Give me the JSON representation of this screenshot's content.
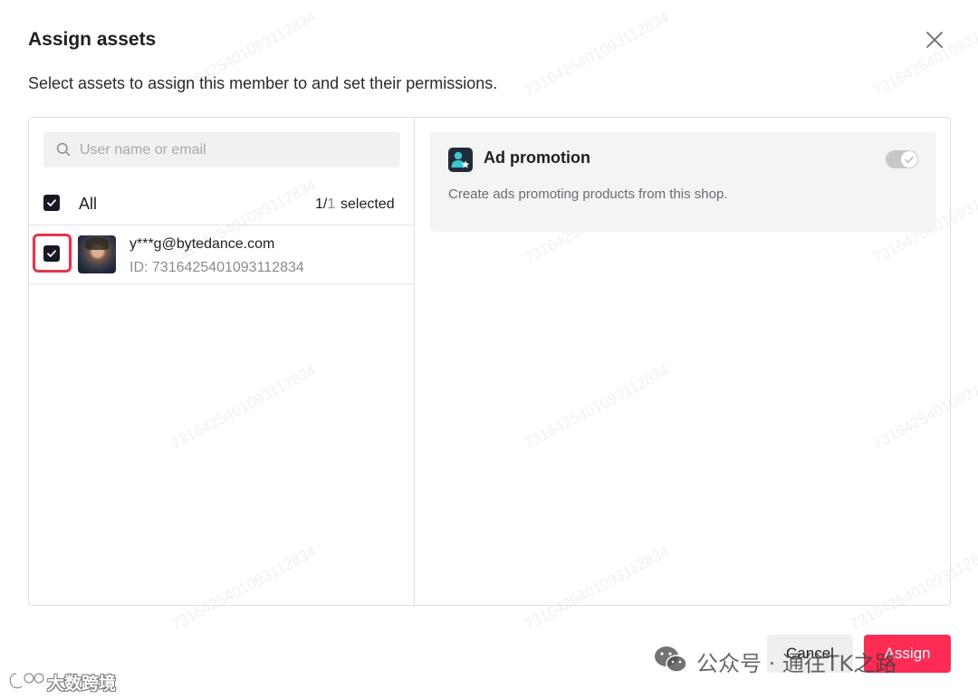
{
  "dialog": {
    "title": "Assign assets",
    "subtitle": "Select assets to assign this member to and set their permissions."
  },
  "search": {
    "placeholder": "User name or email",
    "value": ""
  },
  "list_header": {
    "all_label": "All",
    "selected_count": "1/",
    "total_count": "1",
    "selected_label": "selected",
    "all_checked": true
  },
  "members": [
    {
      "email": "y***g@bytedance.com",
      "id": "ID: 7316425401093112834",
      "checked": true
    }
  ],
  "permission": {
    "title": "Ad promotion",
    "description": "Create ads promoting products from this shop.",
    "enabled": true
  },
  "buttons": {
    "cancel": "Cancel",
    "assign": "Assign"
  },
  "watermark_text": "7316425401093112834",
  "overlay": {
    "wechat_label": "公众号 · 通往TK之路",
    "brand_text": "大数跨境"
  },
  "colors": {
    "primary": "#fe2c55",
    "checkbox": "#161823",
    "highlight": "#e2364a",
    "card_bg": "#f4f4f5"
  },
  "icons": {
    "close": "close-icon",
    "search": "search-icon",
    "check": "check-icon",
    "permission": "user-star-icon"
  }
}
